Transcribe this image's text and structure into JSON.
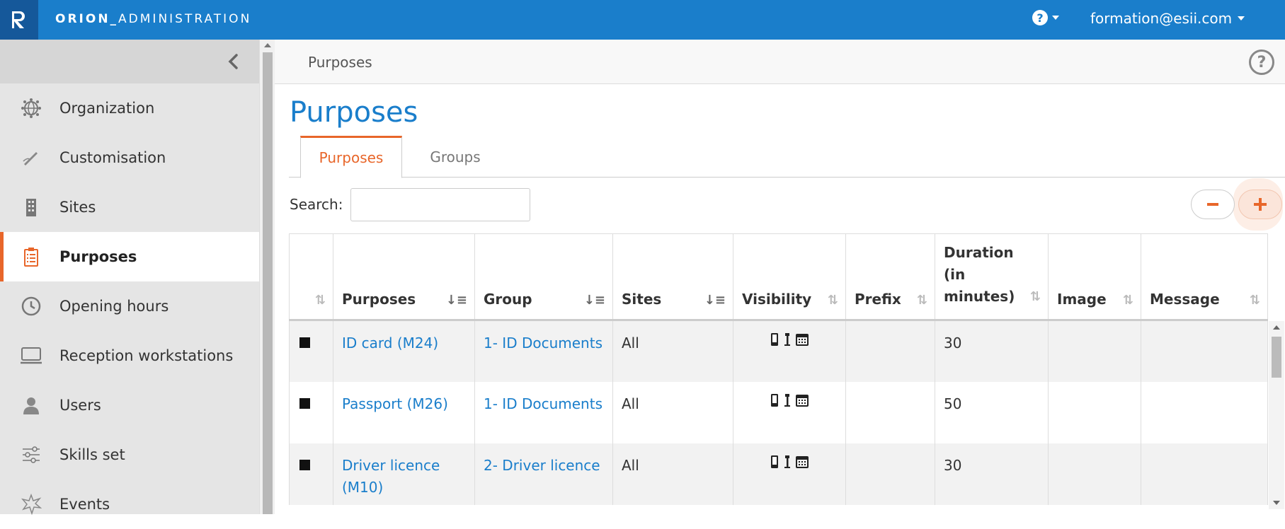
{
  "header": {
    "logo_letter": "R",
    "app_name_bold": "ORION_",
    "app_name_rest": "ADMINISTRATION",
    "user_email": "formation@esii.com"
  },
  "sidebar": {
    "items": [
      {
        "label": "Organization",
        "icon": "globe-network-icon"
      },
      {
        "label": "Customisation",
        "icon": "pen-icon"
      },
      {
        "label": "Sites",
        "icon": "building-icon"
      },
      {
        "label": "Purposes",
        "icon": "clipboard-icon",
        "active": true
      },
      {
        "label": "Opening hours",
        "icon": "clock-icon"
      },
      {
        "label": "Reception workstations",
        "icon": "monitor-icon"
      },
      {
        "label": "Users",
        "icon": "user-icon"
      },
      {
        "label": "Skills set",
        "icon": "sliders-icon"
      },
      {
        "label": "Events",
        "icon": "burst-icon"
      }
    ]
  },
  "breadcrumb": "Purposes",
  "page_title": "Purposes",
  "tabs": [
    {
      "label": "Purposes",
      "active": true
    },
    {
      "label": "Groups",
      "active": false
    }
  ],
  "search": {
    "label": "Search:",
    "value": ""
  },
  "table": {
    "columns": [
      "",
      "Purposes",
      "Group",
      "Sites",
      "Visibility",
      "Prefix",
      "Duration (in minutes)",
      "Image",
      "Message"
    ],
    "rows": [
      {
        "purpose": "ID card (M24)",
        "group": "1- ID Documents",
        "sites": "All",
        "prefix": "",
        "duration": "30",
        "image": "",
        "message": ""
      },
      {
        "purpose": "Passport (M26)",
        "group": "1- ID Documents",
        "sites": "All",
        "prefix": "",
        "duration": "50",
        "image": "",
        "message": ""
      },
      {
        "purpose": "Driver licence (M10)",
        "group": "2- Driver licence",
        "sites": "All",
        "prefix": "",
        "duration": "30",
        "image": "",
        "message": ""
      }
    ]
  },
  "colors": {
    "accent": "#e8662a",
    "brand": "#1a7ecb",
    "topbar": "#1a7ecb",
    "logo_bg": "#15589a"
  }
}
